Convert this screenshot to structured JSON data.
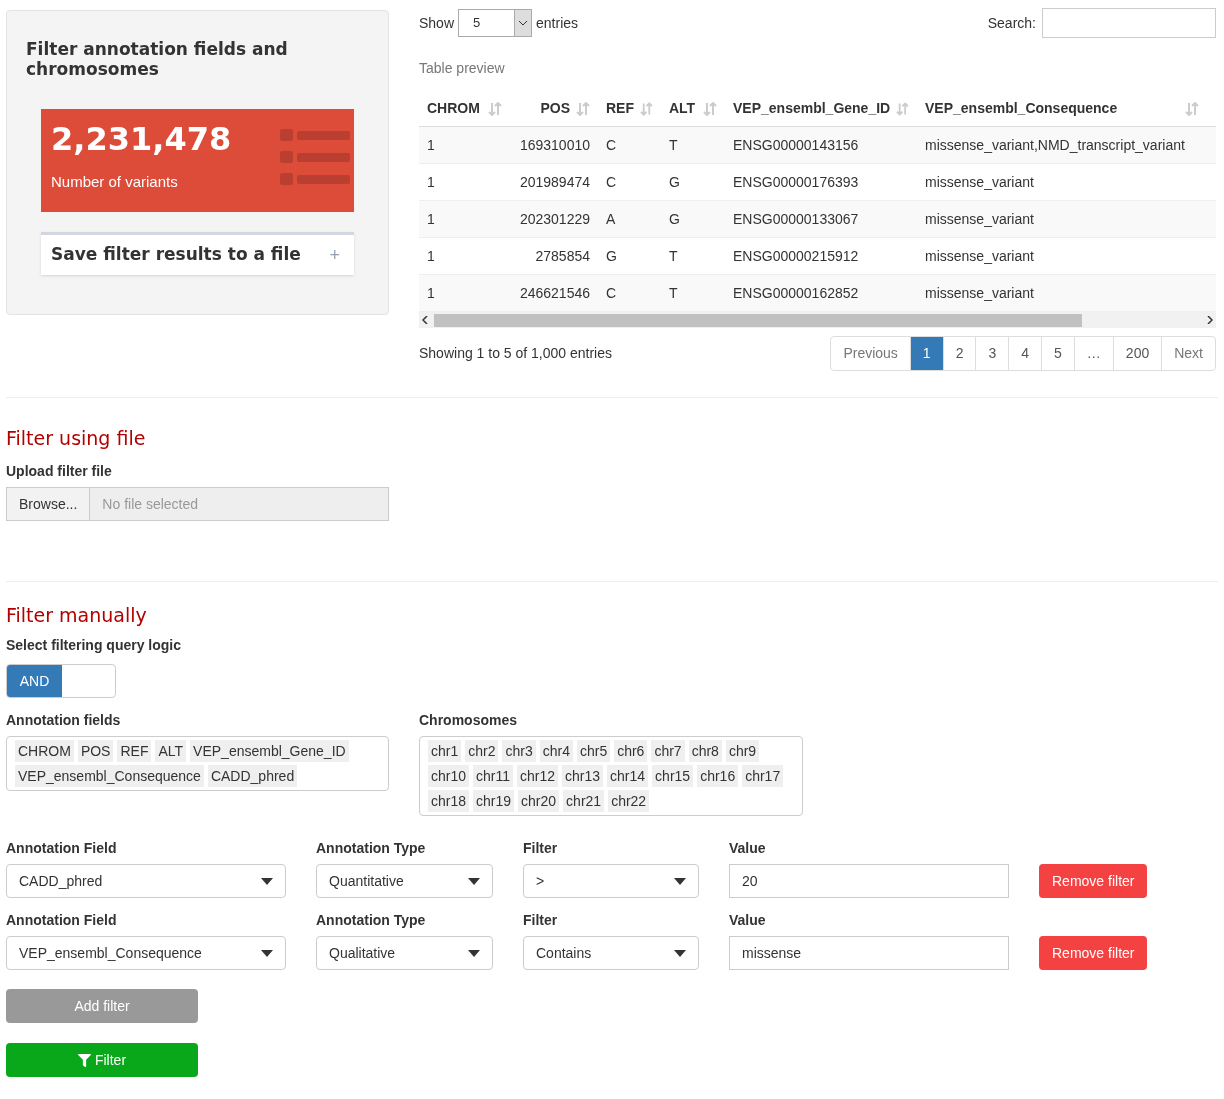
{
  "summary_panel": {
    "title": "Filter annotation fields and chromosomes",
    "stat": {
      "value": "2,231,478",
      "label": "Number of variants"
    },
    "save_box": {
      "label": "Save filter results to a file",
      "icon": "+",
      "expanded": false
    }
  },
  "table_controls": {
    "show_label": "Show",
    "page_size": "5",
    "entries_label": "entries",
    "search_label": "Search:"
  },
  "table": {
    "caption": "Table preview",
    "columns": [
      "CHROM",
      "POS",
      "REF",
      "ALT",
      "VEP_ensembl_Gene_ID",
      "VEP_ensembl_Consequence"
    ],
    "rows": [
      [
        "1",
        "169310010",
        "C",
        "T",
        "ENSG00000143156",
        "missense_variant,NMD_transcript_variant"
      ],
      [
        "1",
        "201989474",
        "C",
        "G",
        "ENSG00000176393",
        "missense_variant"
      ],
      [
        "1",
        "202301229",
        "A",
        "G",
        "ENSG00000133067",
        "missense_variant"
      ],
      [
        "1",
        "2785854",
        "G",
        "T",
        "ENSG00000215912",
        "missense_variant"
      ],
      [
        "1",
        "246621546",
        "C",
        "T",
        "ENSG00000162852",
        "missense_variant"
      ]
    ],
    "info": "Showing 1 to 5 of 1,000 entries",
    "pagination": [
      {
        "label": "Previous",
        "kind": "nav",
        "selected": false
      },
      {
        "label": "1",
        "kind": "page",
        "selected": true
      },
      {
        "label": "2",
        "kind": "page",
        "selected": false
      },
      {
        "label": "3",
        "kind": "page",
        "selected": false
      },
      {
        "label": "4",
        "kind": "page",
        "selected": false
      },
      {
        "label": "5",
        "kind": "page",
        "selected": false
      },
      {
        "label": "…",
        "kind": "ellipsis",
        "selected": false
      },
      {
        "label": "200",
        "kind": "page",
        "selected": false
      },
      {
        "label": "Next",
        "kind": "nav",
        "selected": false
      }
    ]
  },
  "file_section": {
    "heading": "Filter using file",
    "label": "Upload filter file",
    "button": "Browse...",
    "placeholder": "No file selected"
  },
  "manual_section": {
    "heading": "Filter manually",
    "logic_label": "Select filtering query logic",
    "logic_toggle": {
      "label": "AND",
      "on": true
    },
    "annotation_fields": {
      "label": "Annotation fields",
      "tags": [
        "CHROM",
        "POS",
        "REF",
        "ALT",
        "VEP_ensembl_Gene_ID",
        "VEP_ensembl_Consequence",
        "CADD_phred"
      ]
    },
    "chromosomes": {
      "label": "Chromosomes",
      "tags": [
        "chr1",
        "chr2",
        "chr3",
        "chr4",
        "chr5",
        "chr6",
        "chr7",
        "chr8",
        "chr9",
        "chr10",
        "chr11",
        "chr12",
        "chr13",
        "chr14",
        "chr15",
        "chr16",
        "chr17",
        "chr18",
        "chr19",
        "chr20",
        "chr21",
        "chr22"
      ]
    },
    "filters": [
      {
        "field_label": "Annotation Field",
        "field": "CADD_phred",
        "type_label": "Annotation Type",
        "type": "Quantitative",
        "filter_label": "Filter",
        "filter": ">",
        "value_label": "Value",
        "value": "20",
        "remove": "Remove filter"
      },
      {
        "field_label": "Annotation Field",
        "field": "VEP_ensembl_Consequence",
        "type_label": "Annotation Type",
        "type": "Qualitative",
        "filter_label": "Filter",
        "filter": "Contains",
        "value_label": "Value",
        "value": "missense",
        "remove": "Remove filter"
      }
    ],
    "add_button": "Add filter",
    "filter_button": "Filter"
  }
}
